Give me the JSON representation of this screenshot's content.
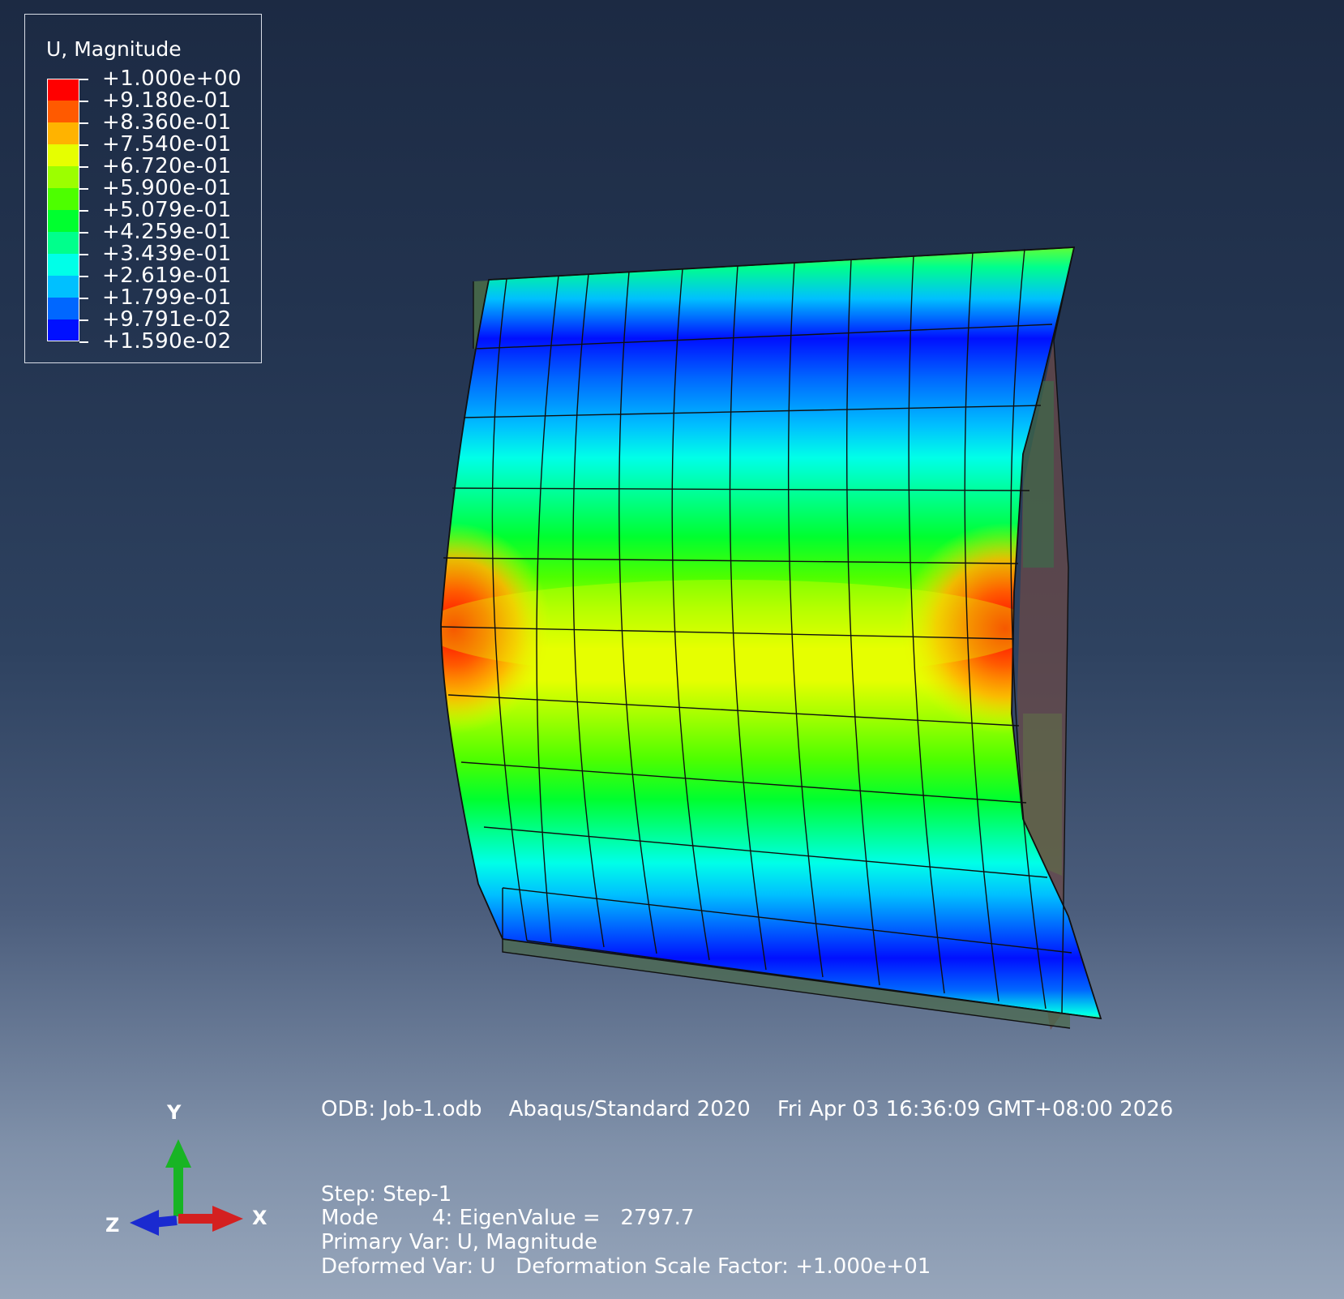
{
  "legend": {
    "title": "U, Magnitude",
    "levels": [
      {
        "label": "+1.000e+00",
        "color": "#ff0000"
      },
      {
        "label": "+9.180e-01",
        "color": "#ff5a00"
      },
      {
        "label": "+8.360e-01",
        "color": "#ffb300"
      },
      {
        "label": "+7.540e-01",
        "color": "#e6ff00"
      },
      {
        "label": "+6.720e-01",
        "color": "#9cff00"
      },
      {
        "label": "+5.900e-01",
        "color": "#4dff00"
      },
      {
        "label": "+5.079e-01",
        "color": "#00ff2f"
      },
      {
        "label": "+4.259e-01",
        "color": "#00ff8c"
      },
      {
        "label": "+3.439e-01",
        "color": "#00ffe8"
      },
      {
        "label": "+2.619e-01",
        "color": "#00c0ff"
      },
      {
        "label": "+1.799e-01",
        "color": "#0067ff"
      },
      {
        "label": "+9.791e-02",
        "color": "#0010ff"
      },
      {
        "label": "+1.590e-02",
        "color": ""
      }
    ]
  },
  "info": {
    "odb_line": "ODB: Job-1.odb    Abaqus/Standard 2020    Fri Apr 03 16:36:09 GMT+08:00 2026",
    "step_line": "Step: Step-1",
    "mode_line": "Mode        4: EigenValue =   2797.7",
    "primary_line": "Primary Var: U, Magnitude",
    "deformed_line": "Deformed Var: U   Deformation Scale Factor: +1.000e+01"
  },
  "triad": {
    "y_label": "Y",
    "x_label": "X",
    "z_label": "Z",
    "y_color": "#18b424",
    "x_color": "#d42020",
    "z_color": "#1a2ad0"
  }
}
